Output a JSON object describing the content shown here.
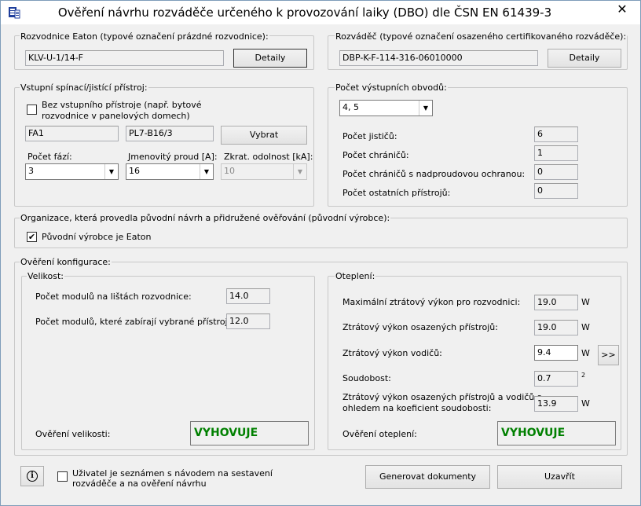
{
  "window": {
    "title": "Ověření návrhu rozváděče určeného k provozování laiky (DBO) dle ČSN EN 61439-3",
    "close": "✕"
  },
  "enclosure": {
    "label": "Rozvodnice Eaton (typové označení prázdné rozvodnice):",
    "value": "KLV-U-1/14-F",
    "details_label": "Detaily"
  },
  "assembly": {
    "label": "Rozváděč (typové označení osazeného certifikovaného rozváděče):",
    "value": "DBP-K-F-114-316-06010000",
    "details_label": "Detaily"
  },
  "input_device": {
    "label": "Vstupní spínací/jistící přístroj:",
    "no_device_line1": "Bez vstupního přístroje (např. bytové",
    "no_device_line2": "rozvodnice v panelových domech)",
    "no_device_checked": false,
    "designation": "FA1",
    "type": "PL7-B16/3",
    "select_label": "Vybrat",
    "phases_label": "Počet fází:",
    "phases_value": "3",
    "current_label": "Jmenovitý proud [A]:",
    "current_value": "16",
    "short_label": "Zkrat. odolnost [kA]:",
    "short_value": "10"
  },
  "output_circuits": {
    "label": "Počet výstupních obvodů:",
    "value": "4, 5",
    "breakers_label": "Počet jističů:",
    "breakers_value": "6",
    "rcd_label": "Počet chráničů:",
    "rcd_value": "1",
    "rcbo_label": "Počet chráničů s nadproudovou ochranou:",
    "rcbo_value": "0",
    "other_label": "Počet ostatních přístrojů:",
    "other_value": "0"
  },
  "organization": {
    "label": "Organizace, která provedla původní návrh a přidružené ověřování (původní výrobce):",
    "eaton_label": "Původní výrobce je Eaton",
    "eaton_checked": true
  },
  "verification": {
    "label": "Ověření konfigurace:",
    "size": {
      "label": "Velikost:",
      "modules_rails_label": "Počet modulů na lištách rozvodnice:",
      "modules_rails_value": "14.0",
      "modules_used_label": "Počet modulů, které zabírají vybrané přístroje:",
      "modules_used_value": "12.0",
      "result_label": "Ověření velikosti:",
      "result_value": "VYHOVUJE"
    },
    "heating": {
      "label": "Oteplení:",
      "max_loss_label": "Maximální ztrátový výkon pro rozvodnici:",
      "max_loss_value": "19.0",
      "devices_loss_label": "Ztrátový výkon osazených přístrojů:",
      "devices_loss_value": "19.0",
      "wires_loss_label": "Ztrátový výkon vodičů:",
      "wires_loss_value": "9.4",
      "more_label": ">>",
      "diversity_label": "Soudobost:",
      "diversity_value": "0.7",
      "diversity_unit": "2",
      "combined_label_line1": "Ztrátový výkon osazených přístrojů a vodičů s",
      "combined_label_line2": "ohledem na koeficient soudobosti:",
      "combined_value": "13.9",
      "unit": "W",
      "result_label": "Ověření oteplení:",
      "result_value": "VYHOVUJE"
    }
  },
  "footer": {
    "info_label": "i",
    "ack_line1": "Uživatel je seznámen s návodem na sestavení",
    "ack_line2": "rozváděče a na ověření návrhu",
    "ack_checked": false,
    "generate_label": "Generovat dokumenty",
    "close_label": "Uzavřít"
  },
  "colors": {
    "result_ok": "#008000"
  }
}
